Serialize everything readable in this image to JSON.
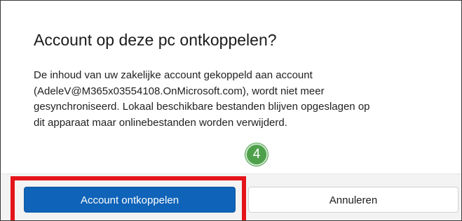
{
  "dialog": {
    "title": "Account op deze pc ontkoppelen?",
    "body_lines": [
      "De inhoud van uw zakelijke account gekoppeld aan account",
      "(AdeleV@M365x03554108.OnMicrosoft.com), wordt niet meer",
      "gesynchroniseerd. Lokaal beschikbare bestanden blijven opgeslagen op",
      "dit apparaat maar onlinebestanden worden verwijderd."
    ],
    "step_badge": "4",
    "primary_button_label": "Account ontkoppelen",
    "secondary_button_label": "Annuleren"
  },
  "colors": {
    "primary_button": "#0f63b8",
    "highlight_border": "#e5141b",
    "step_badge": "#4ea04b",
    "footer_background": "#f3f3f3"
  }
}
